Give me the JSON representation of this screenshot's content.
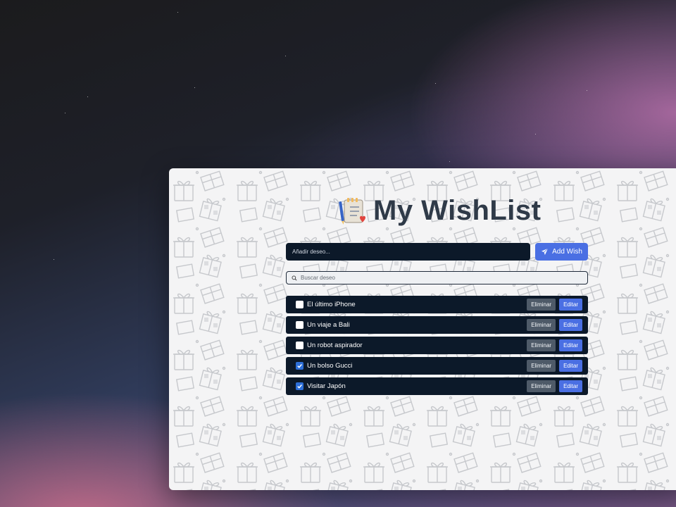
{
  "app": {
    "title": "My WishList"
  },
  "add_form": {
    "placeholder": "Añadir deseo...",
    "button_label": "Add Wish"
  },
  "search": {
    "placeholder": "Buscar deseo"
  },
  "wishes": [
    {
      "label": "El último iPhone",
      "checked": false,
      "delete_label": "Eliminar",
      "edit_label": "Editar"
    },
    {
      "label": "Un viaje a Bali",
      "checked": false,
      "delete_label": "Eliminar",
      "edit_label": "Editar"
    },
    {
      "label": "Un robot aspirador",
      "checked": false,
      "delete_label": "Eliminar",
      "edit_label": "Editar"
    },
    {
      "label": "Un bolso Gucci",
      "checked": true,
      "delete_label": "Eliminar",
      "edit_label": "Editar"
    },
    {
      "label": "Visitar Japón",
      "checked": true,
      "delete_label": "Eliminar",
      "edit_label": "Editar"
    }
  ],
  "colors": {
    "primary": "#4a6fe3",
    "item_background": "#0c1929",
    "delete_button": "#4e5a68",
    "title_text": "#2f3a48",
    "checkbox_checked": "#2d6fd8"
  },
  "icons": {
    "title": "notepad-pen-heart-icon",
    "add_button": "paper-plane-icon",
    "search": "search-icon",
    "checkbox": "checkmark-icon"
  }
}
